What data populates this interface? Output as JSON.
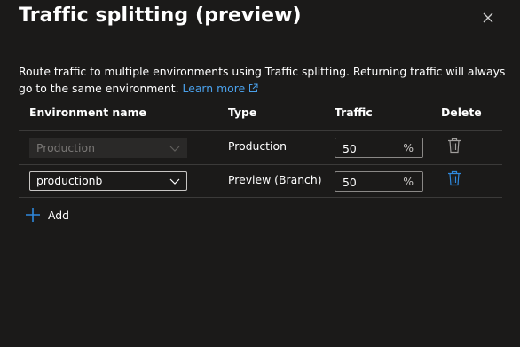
{
  "dialog": {
    "title": "Traffic splitting (preview)",
    "description": "Route traffic to multiple environments using Traffic splitting. Returning traffic will always go to the same environment.",
    "learn_more": "Learn more"
  },
  "table": {
    "headers": [
      "Environment name",
      "Type",
      "Traffic",
      "Delete"
    ],
    "rows": [
      {
        "environment": "Production",
        "type": "Production",
        "traffic": "50",
        "unit": "%",
        "disabled": true
      },
      {
        "environment": "productionb",
        "type": "Preview (Branch)",
        "traffic": "50",
        "unit": "%",
        "disabled": false
      }
    ]
  },
  "actions": {
    "add_label": "Add"
  },
  "colors": {
    "background": "#1b1a19",
    "link": "#4aa0ea",
    "accent": "#2f88dc",
    "border": "#8a8886"
  }
}
